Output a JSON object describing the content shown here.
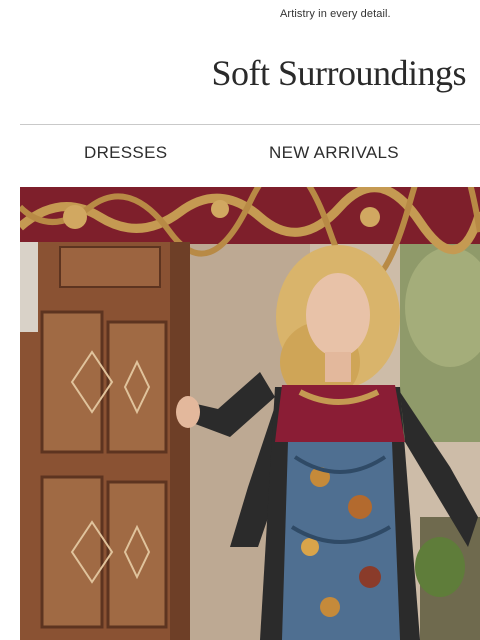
{
  "header": {
    "tagline": "Artistry in every detail.",
    "logo_text": "Soft Surroundings"
  },
  "nav": {
    "items": [
      {
        "label": "DRESSES"
      },
      {
        "label": "NEW ARRIVALS"
      }
    ]
  },
  "hero": {
    "image_description_colors": {
      "door": "#8a5233",
      "banner": "#7e1f2b",
      "gold": "#c59a52",
      "background": "#c9b8a4",
      "dress_blue": "#4f6f91",
      "sleeve": "#2b2b2b"
    }
  }
}
